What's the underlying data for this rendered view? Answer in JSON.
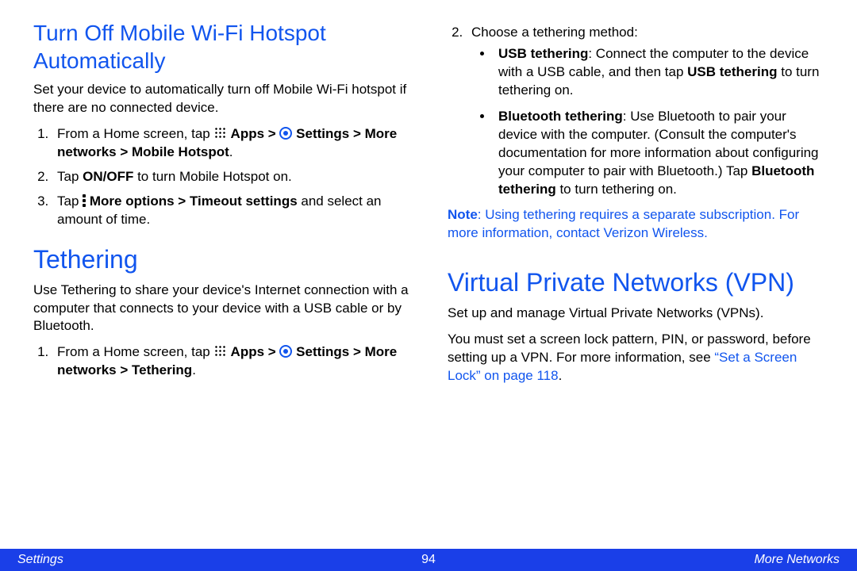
{
  "left": {
    "h1a": "Turn Off Mobile Wi-Fi Hotspot Automatically",
    "p1": "Set your device to automatically turn off Mobile Wi-Fi hotspot if there are no connected device.",
    "s1_pre": "From a Home screen, tap ",
    "s1_apps": " Apps > ",
    "s1_set": " Settings > More networks > Mobile Hotspot",
    "s1_post": ".",
    "s2_pre": "Tap ",
    "s2_b": "ON/OFF",
    "s2_post": " to turn Mobile Hotspot on.",
    "s3_pre": "Tap ",
    "s3_b": " More options > Timeout settings",
    "s3_post": " and select an amount of time.",
    "h1b": "Tethering",
    "p2": "Use Tethering to share your device's Internet connection with a computer that connects to your device with a USB cable or by Bluetooth.",
    "s4_pre": "From a Home screen, tap ",
    "s4_apps": " Apps > ",
    "s4_set": " Settings > More networks > Tethering",
    "s4_post": "."
  },
  "right": {
    "r1": "Choose a tethering method:",
    "b1_b": "USB tethering",
    "b1_t1": ": Connect the computer to the device with a USB cable, and then tap ",
    "b1_b2": "USB tethering",
    "b1_t2": " to turn tethering on.",
    "b2_b": "Bluetooth tethering",
    "b2_t1": ": Use Bluetooth to pair your device with the computer. (Consult the computer's documentation for more information about configuring your computer to pair with Bluetooth.) Tap ",
    "b2_b2": "Bluetooth tethering",
    "b2_t2": " to turn tethering on.",
    "note_b": "Note",
    "note_t": ": Using tethering requires a separate subscription. For more information, contact Verizon Wireless.",
    "h1c": "Virtual Private Networks (VPN)",
    "p3": "Set up and manage Virtual Private Networks (VPNs).",
    "p4a": "You must set a screen lock pattern, PIN, or password, before setting up a VPN. For more information, see ",
    "p4l": "“Set a Screen Lock” on page 118",
    "p4b": "."
  },
  "footer": {
    "left": "Settings",
    "center": "94",
    "right": "More Networks"
  }
}
